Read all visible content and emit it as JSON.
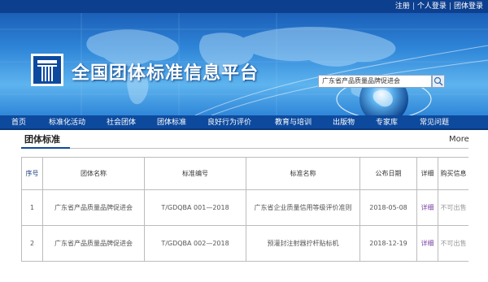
{
  "top_links": [
    "注册",
    "个人登录",
    "团体登录"
  ],
  "site_title": "全国团体标准信息平台",
  "search": {
    "value": "广东省产品质量品牌促进会"
  },
  "nav": [
    "首页",
    "标准化活动",
    "社会团体",
    "团体标准",
    "良好行为评价",
    "教育与培训",
    "出版物",
    "专家库",
    "常见问题"
  ],
  "section": {
    "title": "团体标准",
    "more": "More"
  },
  "table": {
    "headers": [
      "序号",
      "团体名称",
      "标准编号",
      "标准名称",
      "公布日期",
      "详细",
      "购买信息"
    ],
    "rows": [
      [
        "1",
        "广东省产品质量品牌促进会",
        "T/GDQBA 001—2018",
        "广东省企业质量信用等级评价准则",
        "2018-05-08",
        "详细",
        "不可出售"
      ],
      [
        "2",
        "广东省产品质量品牌促进会",
        "T/GDQBA 002—2018",
        "预灌封注射器拧杆贴标机",
        "2018-12-19",
        "详细",
        "不可出售"
      ]
    ]
  },
  "colors": {
    "nav_bg": "#0d4a9e",
    "top_bar": "#0d3f8f",
    "link": "#7a3fa3"
  },
  "icons": [
    "logo-icon",
    "search-icon",
    "world-map-graphic",
    "globe-graphic"
  ]
}
